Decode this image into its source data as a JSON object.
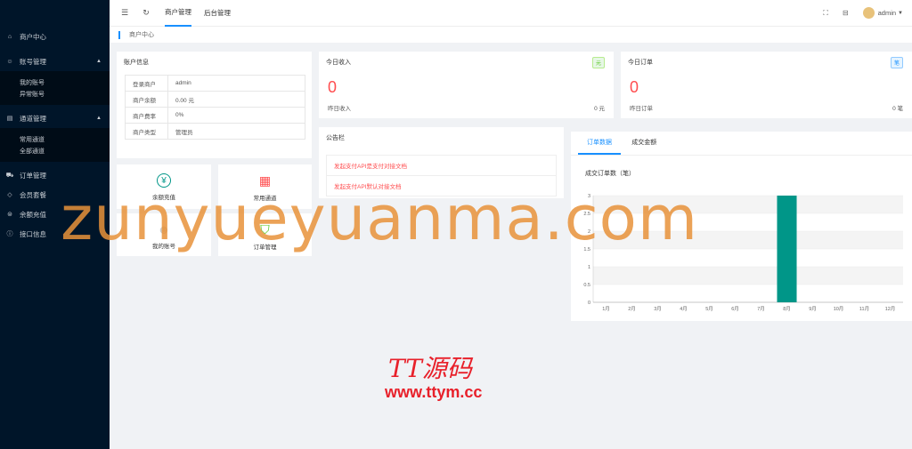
{
  "sidebar": {
    "items": [
      {
        "label": "商户中心",
        "icon": "home-icon"
      },
      {
        "label": "账号管理",
        "icon": "user-icon",
        "expanded": true,
        "children": [
          "我的账号",
          "异常账号"
        ]
      },
      {
        "label": "通道管理",
        "icon": "channel-icon",
        "expanded": true,
        "children": [
          "常用通道",
          "全部通道"
        ]
      },
      {
        "label": "订单管理",
        "icon": "cart-icon"
      },
      {
        "label": "会员套餐",
        "icon": "diamond-icon"
      },
      {
        "label": "余额充值",
        "icon": "wallet-icon"
      },
      {
        "label": "接口信息",
        "icon": "info-icon"
      }
    ]
  },
  "topbar": {
    "tabs": [
      "商户管理",
      "后台管理"
    ],
    "user": "admin"
  },
  "breadcrumb": "商户中心",
  "account_info": {
    "title": "账户信息",
    "rows": [
      {
        "k": "登录商户",
        "v": "admin"
      },
      {
        "k": "商户余额",
        "v": "0.00 元"
      },
      {
        "k": "商户费率",
        "v": "0%"
      },
      {
        "k": "商户类型",
        "v": "管理员"
      }
    ]
  },
  "income": {
    "title": "今日收入",
    "badge": "元",
    "value": "0",
    "footer_label": "昨日收入",
    "footer_value": "0 元"
  },
  "orders": {
    "title": "今日订单",
    "badge": "笔",
    "value": "0",
    "footer_label": "昨日订单",
    "footer_value": "0 笔"
  },
  "quick": [
    {
      "label": "余额充值",
      "icon": "yuan-icon"
    },
    {
      "label": "常用通道",
      "icon": "grid-icon"
    },
    {
      "label": "我的账号",
      "icon": "person-icon"
    },
    {
      "label": "订单管理",
      "icon": "basket-icon"
    }
  ],
  "notice": {
    "title": "公告栏",
    "links": [
      "发起支付API是支付对接文档",
      "发起支付API默认对接文档"
    ]
  },
  "chart_tabs": [
    "订单数据",
    "成交金额"
  ],
  "colors": {
    "accent": "#1890ff",
    "danger": "#ff4d4f",
    "bar": "#009688",
    "sidebar": "#001529"
  },
  "chart_data": {
    "type": "bar",
    "title": "成交订单数（笔）",
    "categories": [
      "1月",
      "2月",
      "3月",
      "4月",
      "5月",
      "6月",
      "7月",
      "8月",
      "9月",
      "10月",
      "11月",
      "12月"
    ],
    "values": [
      0,
      0,
      0,
      0,
      0,
      0,
      0,
      3,
      0,
      0,
      0,
      0
    ],
    "ylim": [
      0,
      3
    ],
    "yticks": [
      "0",
      "0.5",
      "1",
      "1.5",
      "2",
      "2.5",
      "3"
    ],
    "grid": true
  },
  "watermark": {
    "text": "zunyueyuanma.com",
    "logo": "TT源码",
    "url": "www.ttym.cc"
  }
}
